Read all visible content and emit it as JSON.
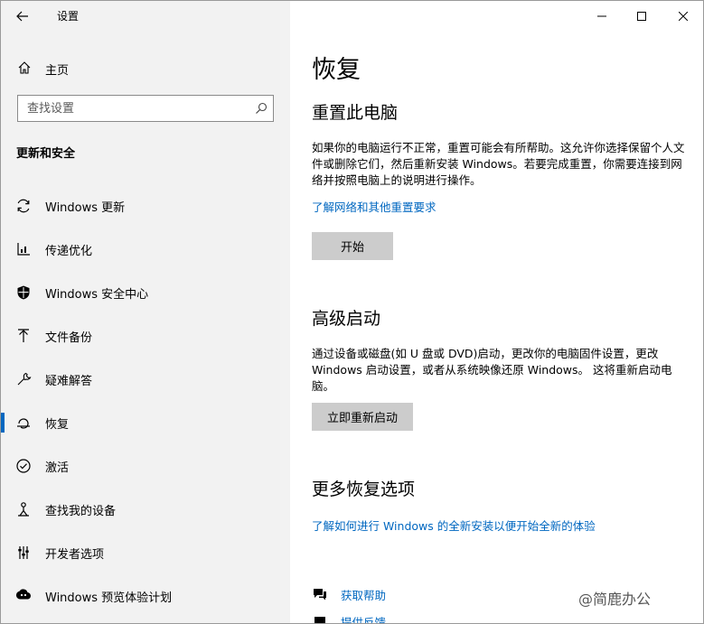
{
  "window": {
    "app_title": "设置"
  },
  "sidebar": {
    "home_label": "主页",
    "search": {
      "placeholder": "查找设置"
    },
    "section_heading": "更新和安全",
    "items": [
      {
        "label": "Windows 更新",
        "icon": "refresh-icon"
      },
      {
        "label": "传递优化",
        "icon": "delivery-optimization-icon"
      },
      {
        "label": "Windows 安全中心",
        "icon": "shield-icon"
      },
      {
        "label": "文件备份",
        "icon": "backup-arrow-icon"
      },
      {
        "label": "疑难解答",
        "icon": "wrench-icon"
      },
      {
        "label": "恢复",
        "icon": "recovery-icon",
        "selected": true
      },
      {
        "label": "激活",
        "icon": "check-circle-icon"
      },
      {
        "label": "查找我的设备",
        "icon": "find-device-icon"
      },
      {
        "label": "开发者选项",
        "icon": "developer-icon"
      },
      {
        "label": "Windows 预览体验计划",
        "icon": "insider-icon"
      }
    ]
  },
  "main": {
    "title": "恢复",
    "reset": {
      "heading": "重置此电脑",
      "description": "如果你的电脑运行不正常，重置可能会有所帮助。这允许你选择保留个人文件或删除它们，然后重新安装 Windows。若要完成重置，你需要连接到网络并按照电脑上的说明进行操作。",
      "link": "了解网络和其他重置要求",
      "button": "开始"
    },
    "advanced": {
      "heading": "高级启动",
      "description": "通过设备或磁盘(如 U 盘或 DVD)启动，更改你的电脑固件设置，更改 Windows 启动设置，或者从系统映像还原 Windows。 这将重新启动电脑。",
      "button": "立即重新启动"
    },
    "more": {
      "heading": "更多恢复选项",
      "link": "了解如何进行 Windows 的全新安装以便开始全新的体验"
    },
    "help": {
      "get_help": "获取帮助",
      "feedback": "提供反馈"
    }
  },
  "watermark": "@简鹿办公",
  "colors": {
    "accent": "#0067c0",
    "sidebar_bg": "#f2f2f2",
    "button_bg": "#cccccc"
  }
}
